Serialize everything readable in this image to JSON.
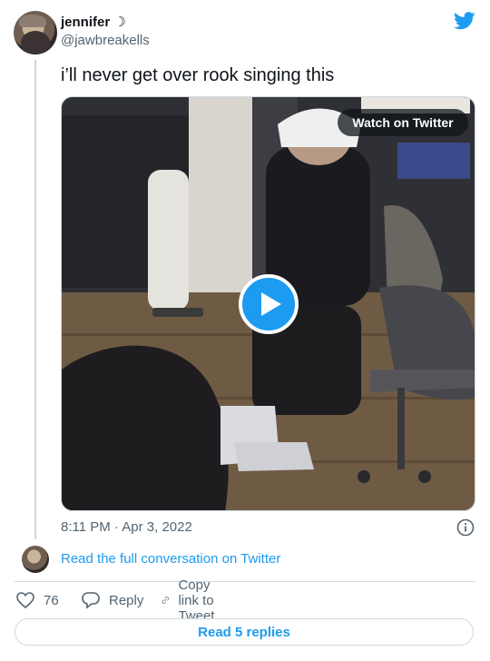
{
  "author": {
    "display_name": "jennifer ☽",
    "handle": "@jawbreakells"
  },
  "tweet": {
    "text": "i’ll never get over rook singing this",
    "timestamp": "8:11 PM · Apr 3, 2022"
  },
  "media": {
    "watch_label": "Watch on Twitter",
    "play_icon": "play-icon"
  },
  "conversation": {
    "link_text": "Read the full conversation on Twitter"
  },
  "actions": {
    "like_count": "76",
    "reply_label": "Reply",
    "copy_label": "Copy link to Tweet"
  },
  "footer": {
    "replies_label": "Read 5 replies"
  },
  "colors": {
    "accent": "#1d9bf0",
    "text_primary": "#0f1419",
    "text_secondary": "#536471",
    "border": "#cfd9de"
  },
  "icons": {
    "brand": "twitter-bird-icon",
    "info": "info-icon",
    "like": "heart-icon",
    "reply": "speech-bubble-icon",
    "copy": "link-icon"
  }
}
